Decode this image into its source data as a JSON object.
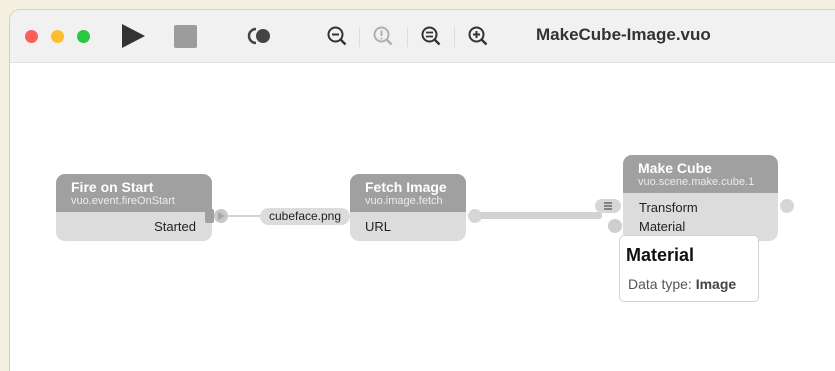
{
  "window": {
    "title": "MakeCube-Image.vuo"
  },
  "toolbar": {
    "icons": [
      "close-light",
      "minimize-light",
      "zoom-light",
      "play-icon",
      "stop-icon",
      "activity-icon",
      "zoom-out-icon",
      "zoom-to-fit-icon",
      "actual-size-icon",
      "zoom-in-icon"
    ]
  },
  "nodes": {
    "fire_on_start": {
      "title": "Fire on Start",
      "class": "vuo.event.fireOnStart",
      "output": "Started"
    },
    "fetch_image": {
      "title": "Fetch Image",
      "class": "vuo.image.fetch",
      "input": "URL",
      "constant": "cubeface.png"
    },
    "make_cube": {
      "title": "Make Cube",
      "class": "vuo.scene.make.cube.1",
      "inputs": [
        "Transform",
        "Material"
      ]
    }
  },
  "tooltip": {
    "title": "Material",
    "label": "Data type:",
    "value": "Image"
  },
  "colors": {
    "node_header": "#a0a0a0",
    "node_body": "#dcdcdc",
    "canvas": "#ffffff",
    "desktop": "#f5efdf"
  }
}
